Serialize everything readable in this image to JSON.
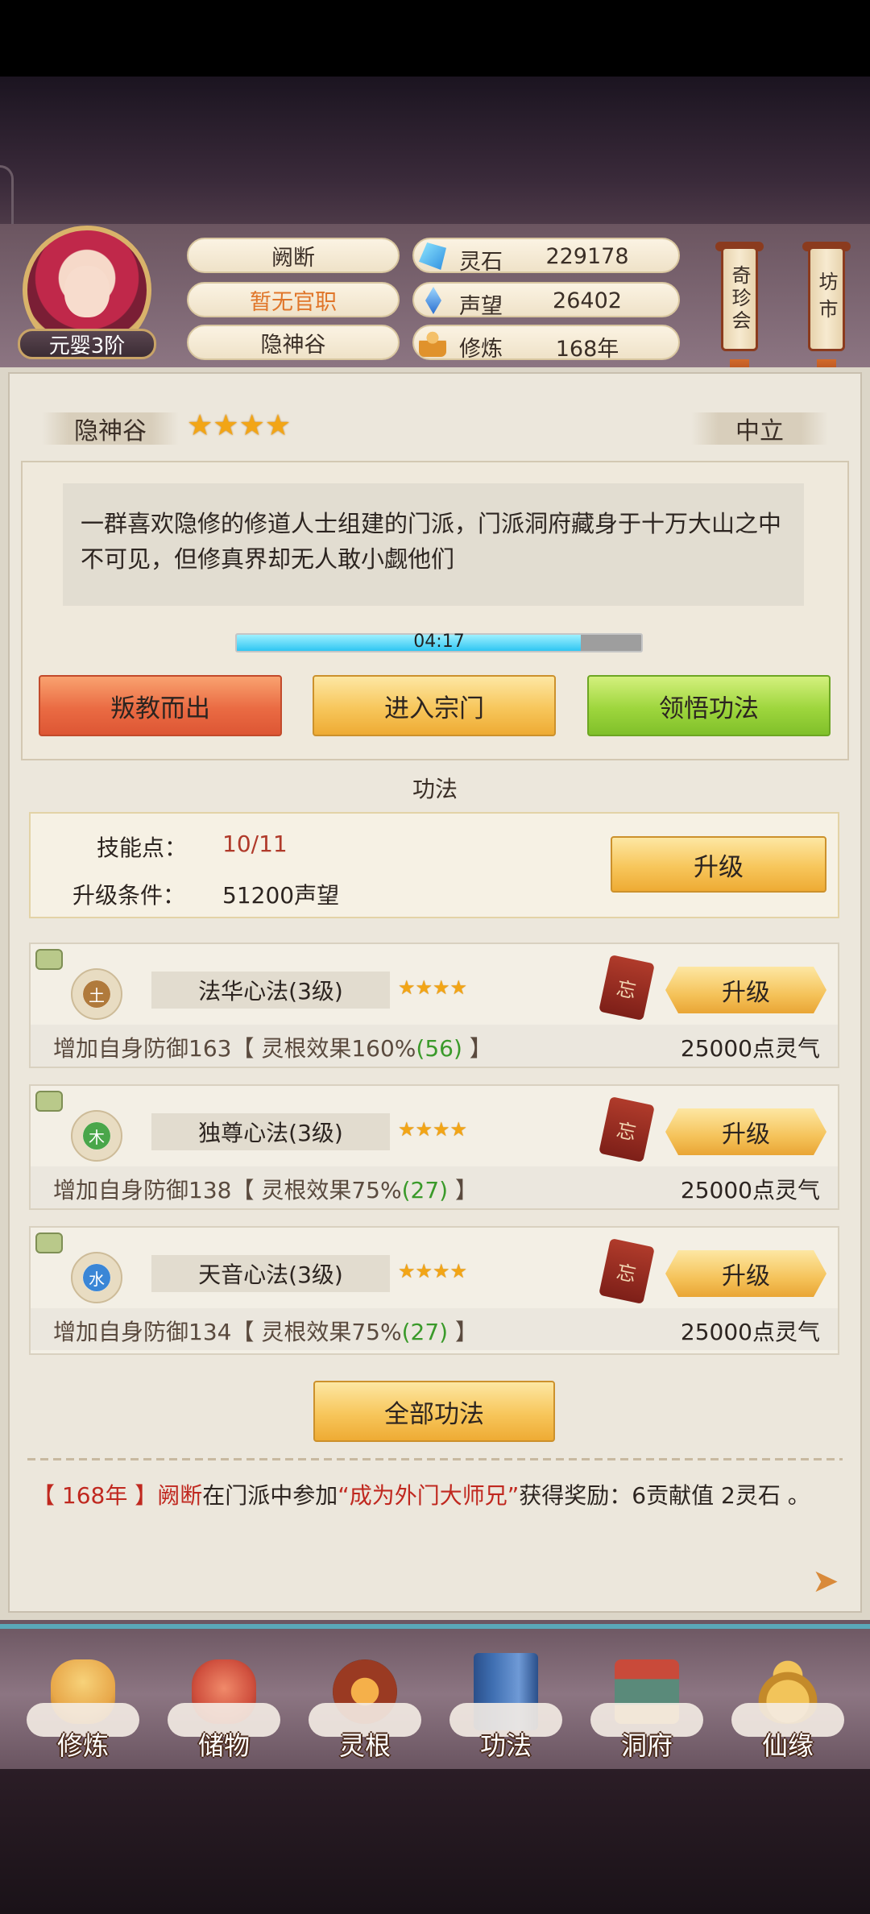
{
  "header": {
    "realm_badge": "元婴3阶",
    "player_name": "阙断",
    "official_title": "暂无官职",
    "sect_name": "隐神谷",
    "resources": [
      {
        "icon": "spirit-stone-icon",
        "label": "灵石",
        "value": "229178"
      },
      {
        "icon": "prestige-icon",
        "label": "声望",
        "value": "26402"
      },
      {
        "icon": "cultivation-icon",
        "label": "修炼",
        "value": "168年"
      }
    ],
    "treasure_shop": "奇珍会",
    "market": "坊市"
  },
  "sect": {
    "name": "隐神谷",
    "star_count": 4,
    "alignment": "中立",
    "description": "一群喜欢隐修的修道人士组建的门派，门派洞府藏身于十万大山之中不可见，但修真界却无人敢小觑他们",
    "timer": "04:17",
    "timer_progress": 0.85,
    "buttons": {
      "leave": "叛教而出",
      "enter": "进入宗门",
      "comprehend": "领悟功法"
    }
  },
  "techniques": {
    "section_title": "功法",
    "skill_points_label": "技能点：",
    "skill_points_value": "10/11",
    "upgrade_condition_label": "升级条件：",
    "upgrade_condition_value": "51200声望",
    "upgrade_label": "升级",
    "items": [
      {
        "element": "土",
        "element_color": "#b07a3c",
        "name": "法华心法(3级)",
        "stars": 4,
        "forget": "忘",
        "upgrade": "升级",
        "effect_prefix": "增加自身防御163【 灵根效果160%",
        "effect_bonus": "(56)",
        "effect_suffix": " 】",
        "cost": "25000点灵气"
      },
      {
        "element": "木",
        "element_color": "#4aa64a",
        "name": "独尊心法(3级)",
        "stars": 4,
        "forget": "忘",
        "upgrade": "升级",
        "effect_prefix": "增加自身防御138【 灵根效果75%",
        "effect_bonus": "(27)",
        "effect_suffix": " 】",
        "cost": "25000点灵气"
      },
      {
        "element": "水",
        "element_color": "#3a86d6",
        "name": "天音心法(3级)",
        "stars": 4,
        "forget": "忘",
        "upgrade": "升级",
        "effect_prefix": "增加自身防御134【 灵根效果75%",
        "effect_bonus": "(27)",
        "effect_suffix": " 】",
        "cost": "25000点灵气"
      }
    ],
    "all_button": "全部功法"
  },
  "log": {
    "year": "【 168年 】",
    "player": "阙断",
    "text1": "在门派中参加",
    "event": "“成为外门大师兄”",
    "text2": "获得奖励：6贡献值 2灵石 。"
  },
  "nav": [
    {
      "icon": "cultivate-icon",
      "label": "修炼",
      "color": "#e8a84a"
    },
    {
      "icon": "storage-bag-icon",
      "label": "储物",
      "color": "#d0503e"
    },
    {
      "icon": "spirit-root-icon",
      "label": "灵根",
      "color": "#9a3a22"
    },
    {
      "icon": "technique-book-icon",
      "label": "功法",
      "color": "#3f6fb2"
    },
    {
      "icon": "cave-dwelling-icon",
      "label": "洞府",
      "color": "#5a8a7a"
    },
    {
      "icon": "fortune-gourd-icon",
      "label": "仙缘",
      "color": "#e0a43a"
    }
  ]
}
